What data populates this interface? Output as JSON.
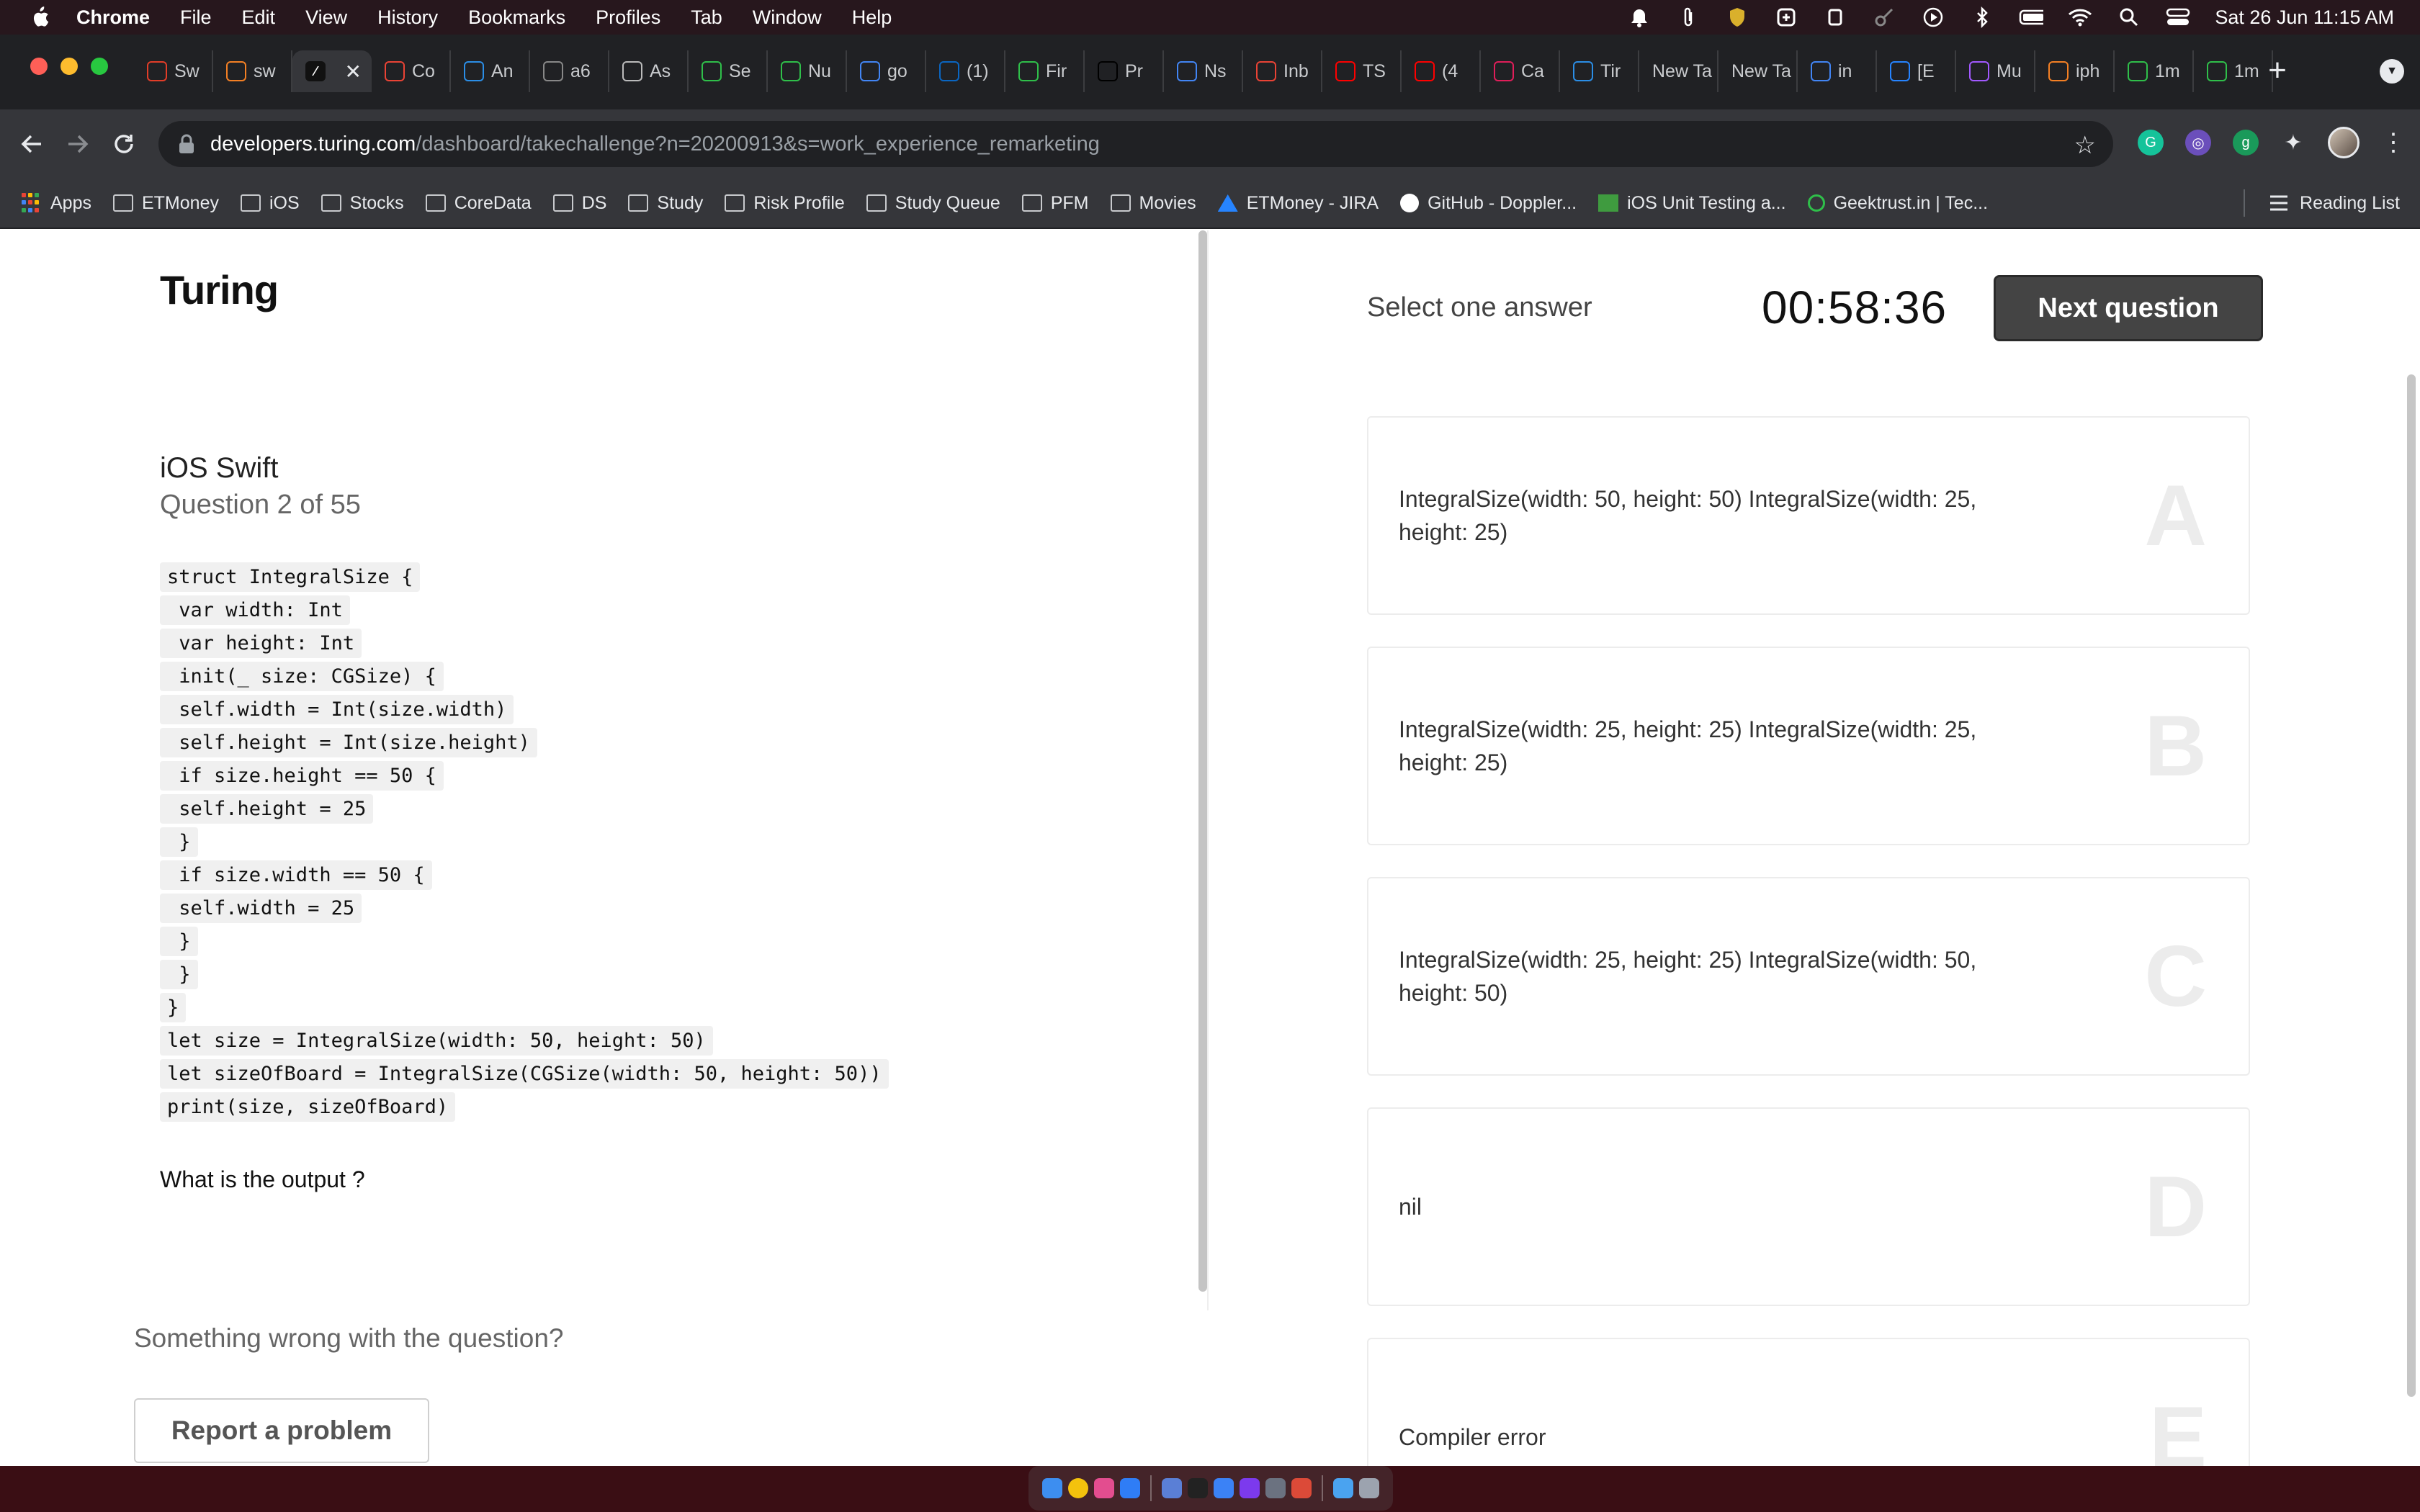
{
  "menubar": {
    "app_name": "Chrome",
    "items": [
      "File",
      "Edit",
      "View",
      "History",
      "Bookmarks",
      "Profiles",
      "Tab",
      "Window",
      "Help"
    ],
    "clock": "Sat 26 Jun  11:15 AM"
  },
  "tabs": [
    {
      "label": "Sw",
      "icon": "swift-icon",
      "color": "#e23d28"
    },
    {
      "label": "sw",
      "icon": "stackoverflow-icon",
      "color": "#f48024"
    },
    {
      "label": "",
      "icon": "turing-icon",
      "color": "#ffffff",
      "active": true
    },
    {
      "label": "Co",
      "icon": "gmail-icon",
      "color": "#ea4335"
    },
    {
      "label": "An",
      "icon": "dictionary-icon",
      "color": "#2b8ee6"
    },
    {
      "label": "a6",
      "icon": "web-icon",
      "color": "#888888"
    },
    {
      "label": "As",
      "icon": "list-icon",
      "color": "#bbbbbb"
    },
    {
      "label": "Se",
      "icon": "phone-icon",
      "color": "#2fbf4a"
    },
    {
      "label": "Nu",
      "icon": "geektrust-icon",
      "color": "#2fbf4a"
    },
    {
      "label": "go",
      "icon": "google-icon",
      "color": "#4285f4"
    },
    {
      "label": "(1)",
      "icon": "linkedin-icon",
      "color": "#0a66c2"
    },
    {
      "label": "Fir",
      "icon": "geektrust-icon",
      "color": "#2fbf4a"
    },
    {
      "label": "Pr",
      "icon": "medium-icon",
      "color": "#000000"
    },
    {
      "label": "Ns",
      "icon": "google-icon",
      "color": "#4285f4"
    },
    {
      "label": "Inb",
      "icon": "gmail-icon",
      "color": "#ea4335"
    },
    {
      "label": "TS",
      "icon": "youtube-icon",
      "color": "#ff0000"
    },
    {
      "label": "(4",
      "icon": "youtube-icon",
      "color": "#ff0000"
    },
    {
      "label": "Ca",
      "icon": "slack-icon",
      "color": "#e01e5a"
    },
    {
      "label": "Tir",
      "icon": "dictionary-icon",
      "color": "#2b8ee6"
    },
    {
      "label": "New Ta",
      "icon": "none"
    },
    {
      "label": "New Ta",
      "icon": "none"
    },
    {
      "label": "in",
      "icon": "google-icon",
      "color": "#4285f4"
    },
    {
      "label": "[E",
      "icon": "jira-icon",
      "color": "#2684ff"
    },
    {
      "label": "Mu",
      "icon": "figma-icon",
      "color": "#a259ff"
    },
    {
      "label": "iph",
      "icon": "stackoverflow-icon",
      "color": "#f48024"
    },
    {
      "label": "1m",
      "icon": "geektrust-icon",
      "color": "#2fbf4a"
    },
    {
      "label": "1m",
      "icon": "geektrust-icon",
      "color": "#2fbf4a"
    }
  ],
  "url": {
    "host": "developers.turing.com",
    "path": "/dashboard/takechallenge?n=20200913&s=work_experience_remarketing"
  },
  "bookmarks": [
    {
      "label": "Apps",
      "icon": "apps-grid-icon"
    },
    {
      "label": "ETMoney",
      "icon": "folder-icon"
    },
    {
      "label": "iOS",
      "icon": "folder-icon"
    },
    {
      "label": "Stocks",
      "icon": "folder-icon"
    },
    {
      "label": "CoreData",
      "icon": "folder-icon"
    },
    {
      "label": "DS",
      "icon": "folder-icon"
    },
    {
      "label": "Study",
      "icon": "folder-icon"
    },
    {
      "label": "Risk Profile",
      "icon": "folder-icon"
    },
    {
      "label": "Study Queue",
      "icon": "folder-icon"
    },
    {
      "label": "PFM",
      "icon": "folder-icon"
    },
    {
      "label": "Movies",
      "icon": "folder-icon"
    },
    {
      "label": "ETMoney - JIRA",
      "icon": "jira-icon"
    },
    {
      "label": "GitHub - Doppler...",
      "icon": "github-icon"
    },
    {
      "label": "iOS Unit Testing a...",
      "icon": "bookmark-icon"
    },
    {
      "label": "Geektrust.in | Tec...",
      "icon": "geektrust-icon"
    }
  ],
  "reading_list": "Reading List",
  "page": {
    "logo": "Turing",
    "subject": "iOS Swift",
    "question_number": "Question 2 of 55",
    "code_lines": [
      "struct IntegralSize {",
      " var width: Int",
      " var height: Int",
      " init(_ size: CGSize) {",
      " self.width = Int(size.width)",
      " self.height = Int(size.height)",
      " if size.height == 50 {",
      " self.height = 25",
      " }",
      " if size.width == 50 {",
      " self.width = 25",
      " }",
      " }",
      "}",
      "let size = IntegralSize(width: 50, height: 50)",
      "let sizeOfBoard = IntegralSize(CGSize(width: 50, height: 50))",
      "print(size, sizeOfBoard)"
    ],
    "prompt": "What is the output ?",
    "wrong_label": "Something wrong with the question?",
    "report_button": "Report a problem",
    "select_label": "Select one answer",
    "timer": "00:58:36",
    "next_button": "Next question",
    "options": [
      {
        "letter": "A",
        "text": "IntegralSize(width: 50, height: 50) IntegralSize(width: 25, height: 25)"
      },
      {
        "letter": "B",
        "text": "IntegralSize(width: 25, height: 25) IntegralSize(width: 25, height: 25)"
      },
      {
        "letter": "C",
        "text": "IntegralSize(width: 25, height: 25) IntegralSize(width: 50, height: 50)"
      },
      {
        "letter": "D",
        "text": "nil"
      },
      {
        "letter": "E",
        "text": "Compiler error"
      }
    ]
  },
  "colors": {
    "accent_button": "#444444",
    "menubar_bg": "#27171d",
    "tabstrip_bg": "#202124",
    "toolbar_bg": "#35363a"
  }
}
